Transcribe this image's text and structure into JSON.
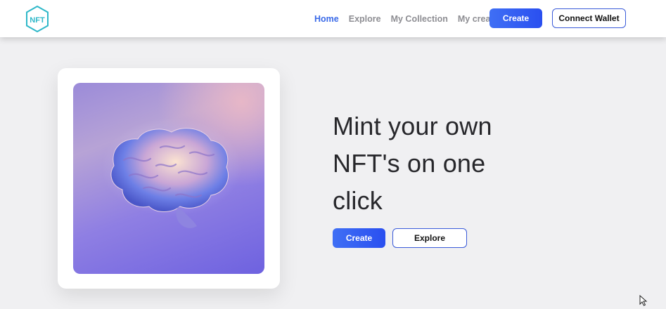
{
  "logo": {
    "icon": "nft-hexagon-logo",
    "text": "NFT",
    "color": "#2fb8c9"
  },
  "nav": {
    "links": [
      {
        "label": "Home",
        "active": true
      },
      {
        "label": "Explore",
        "active": false
      },
      {
        "label": "My Collection",
        "active": false
      },
      {
        "label": "My creater",
        "active": false
      }
    ],
    "create_label": "Create",
    "wallet_label": "Connect Wallet"
  },
  "hero": {
    "title_lines": [
      "Mint your own",
      "NFT's on one",
      "click"
    ],
    "create_label": "Create",
    "explore_label": "Explore",
    "image": {
      "icon": "brain-illustration"
    }
  },
  "colors": {
    "accent": "#3a6ae8",
    "button_gradient_start": "#3f6ff5",
    "button_gradient_end": "#2a4ff0",
    "background": "#f0f0f2",
    "title": "#27272b"
  }
}
